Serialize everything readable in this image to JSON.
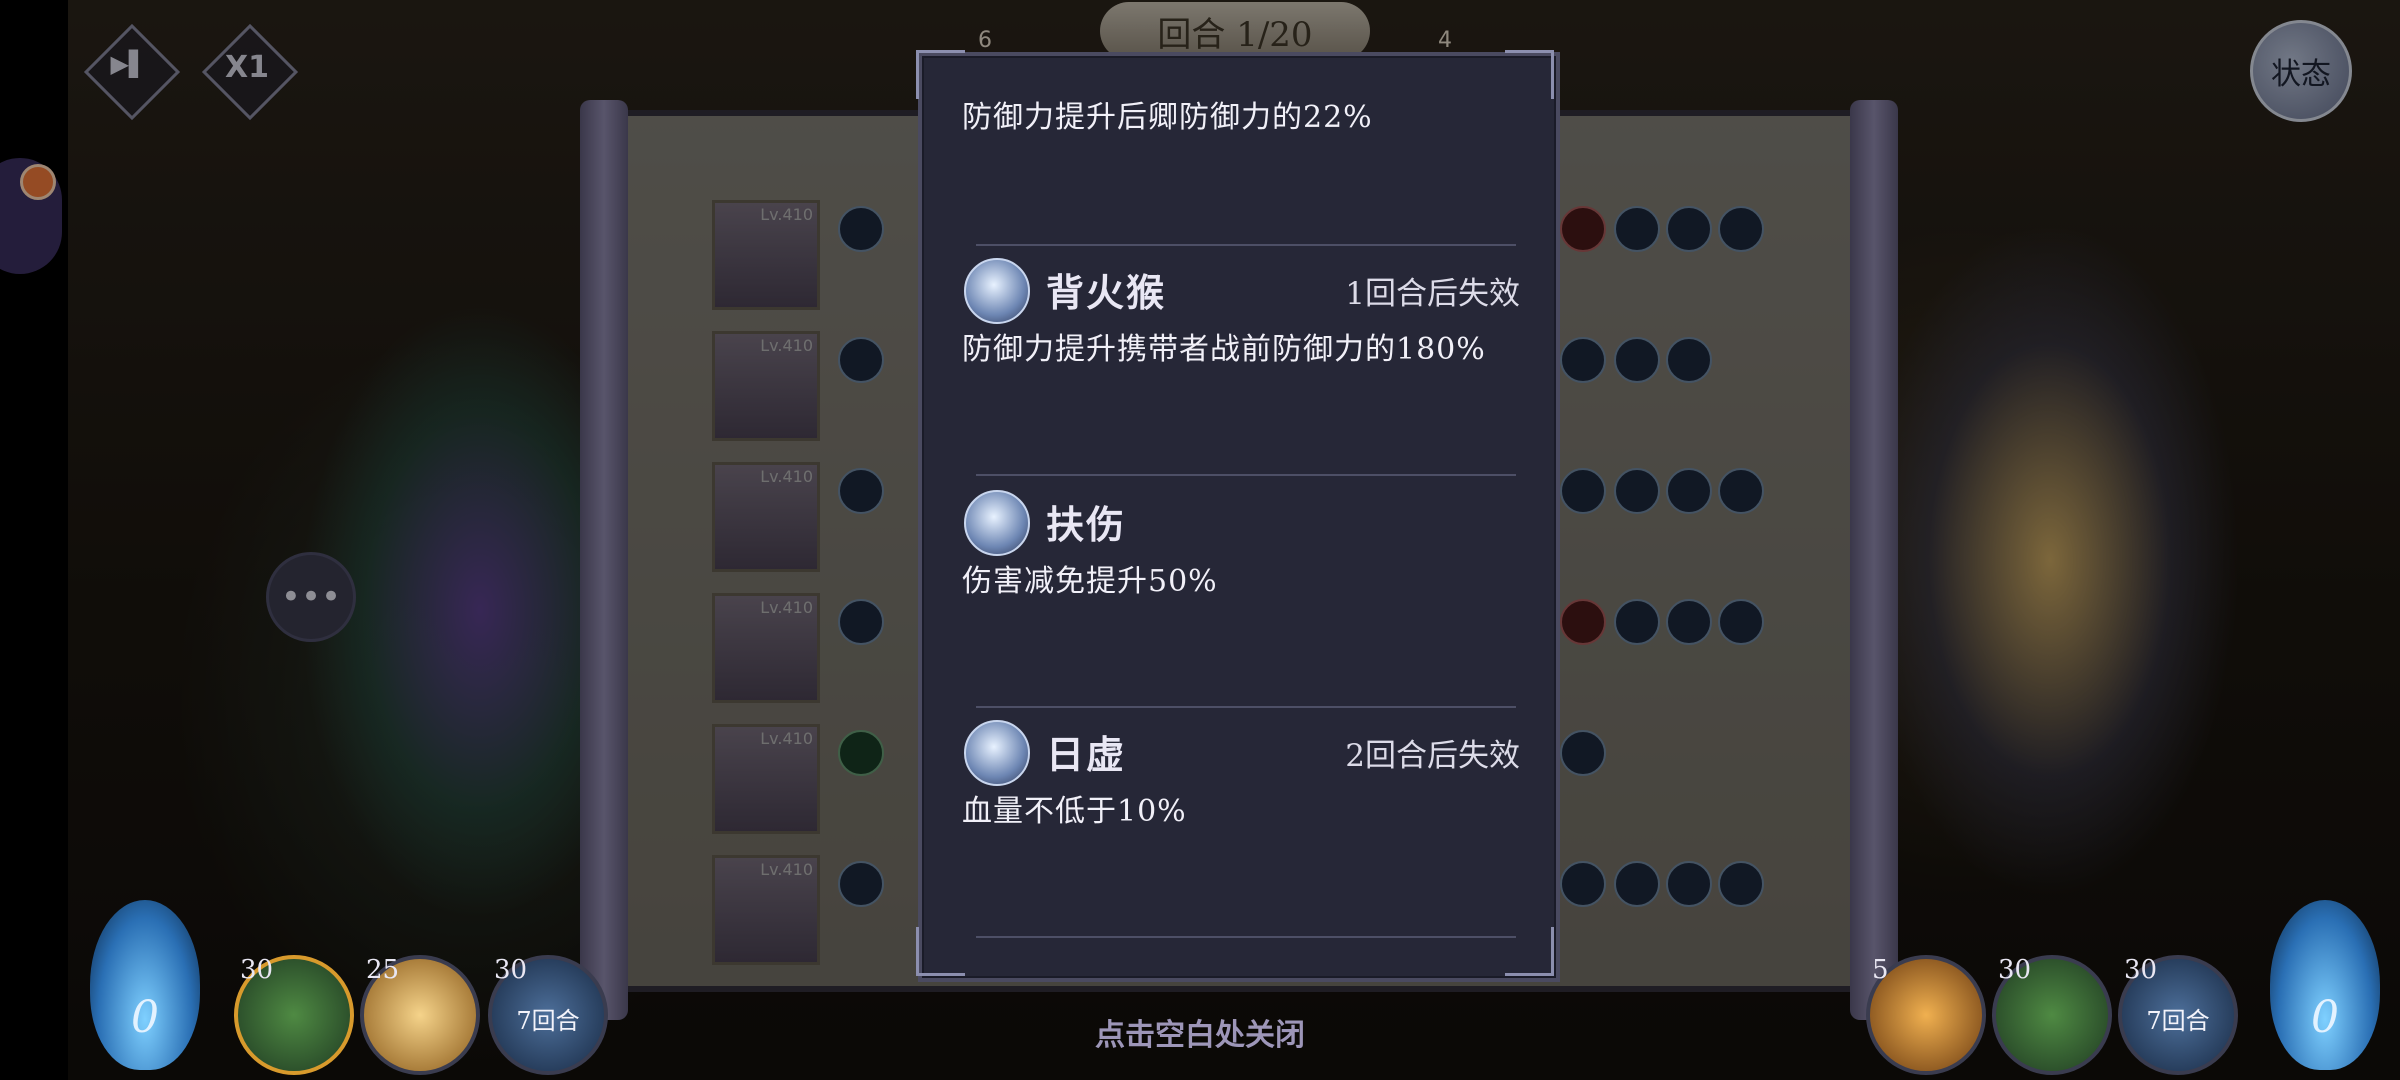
{
  "hud": {
    "skip_label": "▶▌",
    "speed_label": "X1",
    "round_text": "回合 1/20",
    "left_count": "6",
    "right_count": "4",
    "status_label": "状态"
  },
  "team_levels": [
    "Lv.410",
    "Lv.410",
    "Lv.410",
    "Lv.410",
    "Lv.410",
    "Lv.410"
  ],
  "panel": {
    "top_desc": "防御力提升后卿防御力的22%",
    "buffs": [
      {
        "name": "背火猴",
        "duration": "1回合后失效",
        "desc": "防御力提升携带者战前防御力的180%",
        "icon": "shield-up-icon"
      },
      {
        "name": "扶伤",
        "duration": "",
        "desc": "伤害减免提升50%",
        "icon": "heal-hands-icon"
      },
      {
        "name": "日虚",
        "duration": "2回合后失效",
        "desc": "血量不低于10%",
        "icon": "star-burst-icon"
      }
    ]
  },
  "close_hint": "点击空白处关闭",
  "skills_left": [
    {
      "cost": "30",
      "label": ""
    },
    {
      "cost": "25",
      "label": ""
    },
    {
      "cost": "30",
      "label": "7回合"
    }
  ],
  "skills_right": [
    {
      "cost": "5",
      "label": ""
    },
    {
      "cost": "30",
      "label": ""
    },
    {
      "cost": "30",
      "label": "7回合"
    }
  ],
  "energy_left": "0",
  "energy_right": "0",
  "colors": {
    "panel_bg": "#262737",
    "text": "#f1f0f8",
    "hint": "#9d96b8"
  }
}
